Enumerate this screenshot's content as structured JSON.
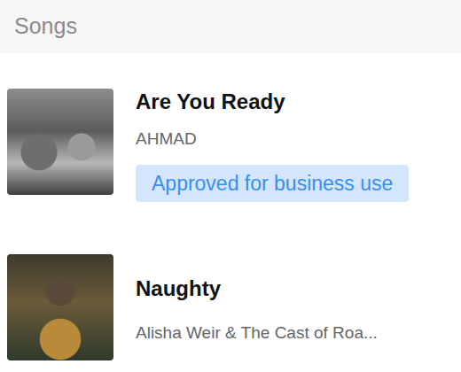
{
  "header": {
    "title": "Songs"
  },
  "songs": [
    {
      "title": "Are You Ready",
      "artist": "AHMAD",
      "badge": "Approved for business use"
    },
    {
      "title": "Naughty",
      "artist": "Alisha Weir & The Cast of Roa..."
    }
  ]
}
